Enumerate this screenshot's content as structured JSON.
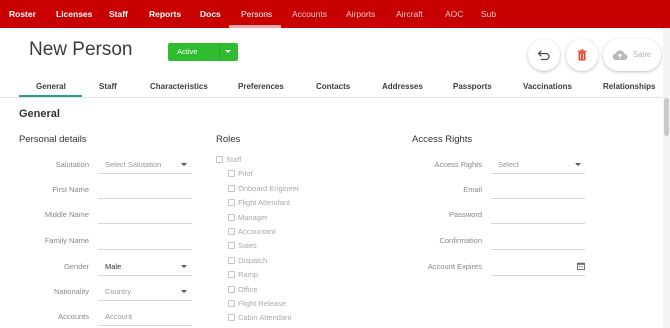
{
  "nav": {
    "items": [
      {
        "label": "Roster",
        "state": "primary"
      },
      {
        "label": "Licenses",
        "state": "primary"
      },
      {
        "label": "Staff",
        "state": "primary"
      },
      {
        "label": "Reports",
        "state": "primary"
      },
      {
        "label": "Docs",
        "state": "primary"
      },
      {
        "label": "Persons",
        "state": "active"
      },
      {
        "label": "Accounts",
        "state": "dim"
      },
      {
        "label": "Airports",
        "state": "dim"
      },
      {
        "label": "Aircraft",
        "state": "dim"
      },
      {
        "label": "AOC",
        "state": "dim"
      },
      {
        "label": "Sub",
        "state": "dim"
      }
    ]
  },
  "header": {
    "title": "New Person",
    "status_value": "Active",
    "save_label": "Save"
  },
  "tabs": [
    "General",
    "Staff",
    "Characteristics",
    "Preferences",
    "Contacts",
    "Addresses",
    "Passports",
    "Vaccinations",
    "Relationships"
  ],
  "section": {
    "title": "General"
  },
  "personal": {
    "title": "Personal details",
    "fields": {
      "salutation": {
        "label": "Salutation",
        "value": "Select Salutation"
      },
      "first_name": {
        "label": "First Name",
        "value": ""
      },
      "middle_name": {
        "label": "Middle Name",
        "value": ""
      },
      "family_name": {
        "label": "Family Name",
        "value": ""
      },
      "gender": {
        "label": "Gender",
        "value": "Male"
      },
      "nationality": {
        "label": "Nationality",
        "value": "Country"
      },
      "accounts": {
        "label": "Accounts",
        "value": "Account"
      }
    }
  },
  "roles": {
    "title": "Roles",
    "parent": "Staff",
    "items": [
      "Pilot",
      "Onboard Engineer",
      "Flight Attendant",
      "Manager",
      "Accountant",
      "Sales",
      "Dispatch",
      "Ramp",
      "Office",
      "Flight Release",
      "Cabin Attendant"
    ]
  },
  "access": {
    "title": "Access Rights",
    "fields": {
      "access_rights": {
        "label": "Access Rights",
        "value": "Select"
      },
      "email": {
        "label": "Email",
        "value": ""
      },
      "password": {
        "label": "Password",
        "value": ""
      },
      "confirmation": {
        "label": "Confirmation",
        "value": ""
      },
      "account_expires": {
        "label": "Account Expires",
        "value": ""
      }
    }
  },
  "colors": {
    "brand": "#c80000",
    "status": "#2fbd2f",
    "accent": "#2a9d8f",
    "delete": "#e04a2c"
  },
  "icons": {
    "undo": "undo-icon",
    "delete": "trash-icon",
    "save": "cloud-upload-icon",
    "calendar": "calendar-icon",
    "dropdown": "chevron-down-icon"
  }
}
